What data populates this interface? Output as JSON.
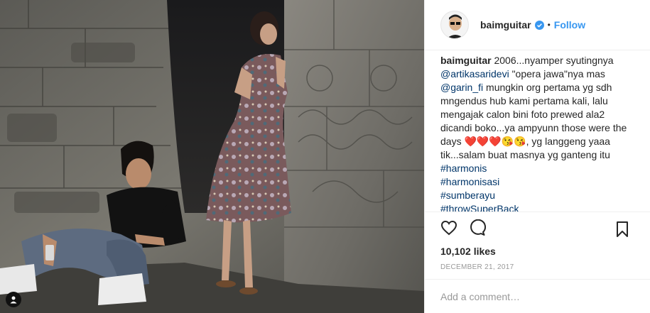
{
  "post": {
    "username": "baimguitar",
    "follow_label": "Follow",
    "dot": "•",
    "caption": {
      "username": "baimguitar",
      "text_1": " 2006...nyamper syutingnya ",
      "mention_1": "@artikasaridevi",
      "text_2": " \"opera jawa\"nya mas ",
      "mention_2": "@garin_fi",
      "text_3": " mungkin org pertama yg sdh mngendus hub kami pertama kali, lalu mengajak calon bini foto prewed ala2 dicandi boko...ya ampyunn those were the days ",
      "emoji": "❤️❤️❤️😘😘",
      "text_4": ", yg langgeng yaaa tik...salam buat masnya yg ganteng itu",
      "hashtags": [
        "#harmonis",
        "#harmonisasi",
        "#sumberayu",
        "#throwSuperBack"
      ]
    },
    "likes": "10,102 likes",
    "date": "DECEMBER 21, 2017",
    "comment_placeholder": "Add a comment…"
  },
  "icons": {
    "verified": "verified-badge-icon",
    "like": "heart-icon",
    "comment": "comment-bubble-icon",
    "save": "bookmark-icon",
    "tag": "user-tag-icon"
  },
  "colors": {
    "link": "#3897f0",
    "hashtag": "#003569",
    "muted": "#999999",
    "border": "#efefef"
  }
}
